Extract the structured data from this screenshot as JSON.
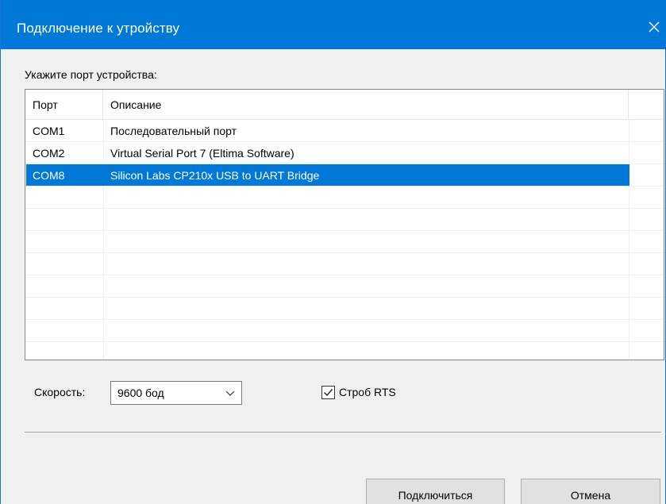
{
  "window": {
    "title": "Подключение к утройству"
  },
  "prompt_label": "Укажите порт устройства:",
  "ports_table": {
    "columns": [
      "Порт",
      "Описание"
    ],
    "rows": [
      {
        "port": "COM1",
        "description": "Последовательный порт",
        "selected": false
      },
      {
        "port": "COM2",
        "description": "Virtual Serial Port 7 (Eltima Software)",
        "selected": false
      },
      {
        "port": "COM8",
        "description": "Silicon Labs CP210x USB to UART Bridge",
        "selected": true
      }
    ],
    "empty_rows": 8
  },
  "speed": {
    "label": "Скорость:",
    "value": "9600 бод"
  },
  "rts": {
    "label": "Строб RTS",
    "checked": true
  },
  "buttons": {
    "connect": "Подключиться",
    "cancel": "Отмена"
  },
  "colors": {
    "titlebar": "#0078d7",
    "selection": "#0078d7"
  },
  "icons": {
    "close": "close-icon",
    "dropdown": "chevron-down-icon",
    "check": "checkmark-icon"
  }
}
